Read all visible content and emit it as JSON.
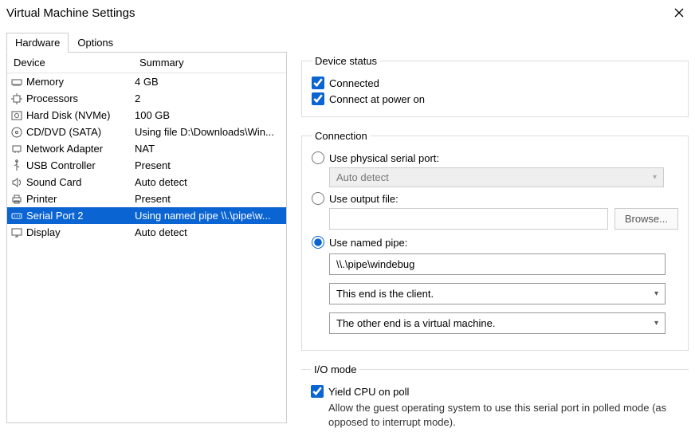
{
  "window_title": "Virtual Machine Settings",
  "tabs": {
    "hardware": "Hardware",
    "options": "Options"
  },
  "columns": {
    "device": "Device",
    "summary": "Summary"
  },
  "devices": [
    {
      "name": "Memory",
      "summary": "4 GB"
    },
    {
      "name": "Processors",
      "summary": "2"
    },
    {
      "name": "Hard Disk (NVMe)",
      "summary": "100 GB"
    },
    {
      "name": "CD/DVD (SATA)",
      "summary": "Using file D:\\Downloads\\Win..."
    },
    {
      "name": "Network Adapter",
      "summary": "NAT"
    },
    {
      "name": "USB Controller",
      "summary": "Present"
    },
    {
      "name": "Sound Card",
      "summary": "Auto detect"
    },
    {
      "name": "Printer",
      "summary": "Present"
    },
    {
      "name": "Serial Port 2",
      "summary": "Using named pipe \\\\.\\pipe\\w..."
    },
    {
      "name": "Display",
      "summary": "Auto detect"
    }
  ],
  "device_status": {
    "legend": "Device status",
    "connected": "Connected",
    "connect_at_power_on": "Connect at power on"
  },
  "connection": {
    "legend": "Connection",
    "use_physical": "Use physical serial port:",
    "physical_value": "Auto detect",
    "use_output": "Use output file:",
    "browse": "Browse...",
    "use_named_pipe": "Use named pipe:",
    "pipe_value": "\\\\.\\pipe\\windebug",
    "end1": "This end is the client.",
    "end2": "The other end is a virtual machine."
  },
  "io_mode": {
    "legend": "I/O mode",
    "yield": "Yield CPU on poll",
    "help": "Allow the guest operating system to use this serial port in polled mode (as opposed to interrupt mode)."
  }
}
